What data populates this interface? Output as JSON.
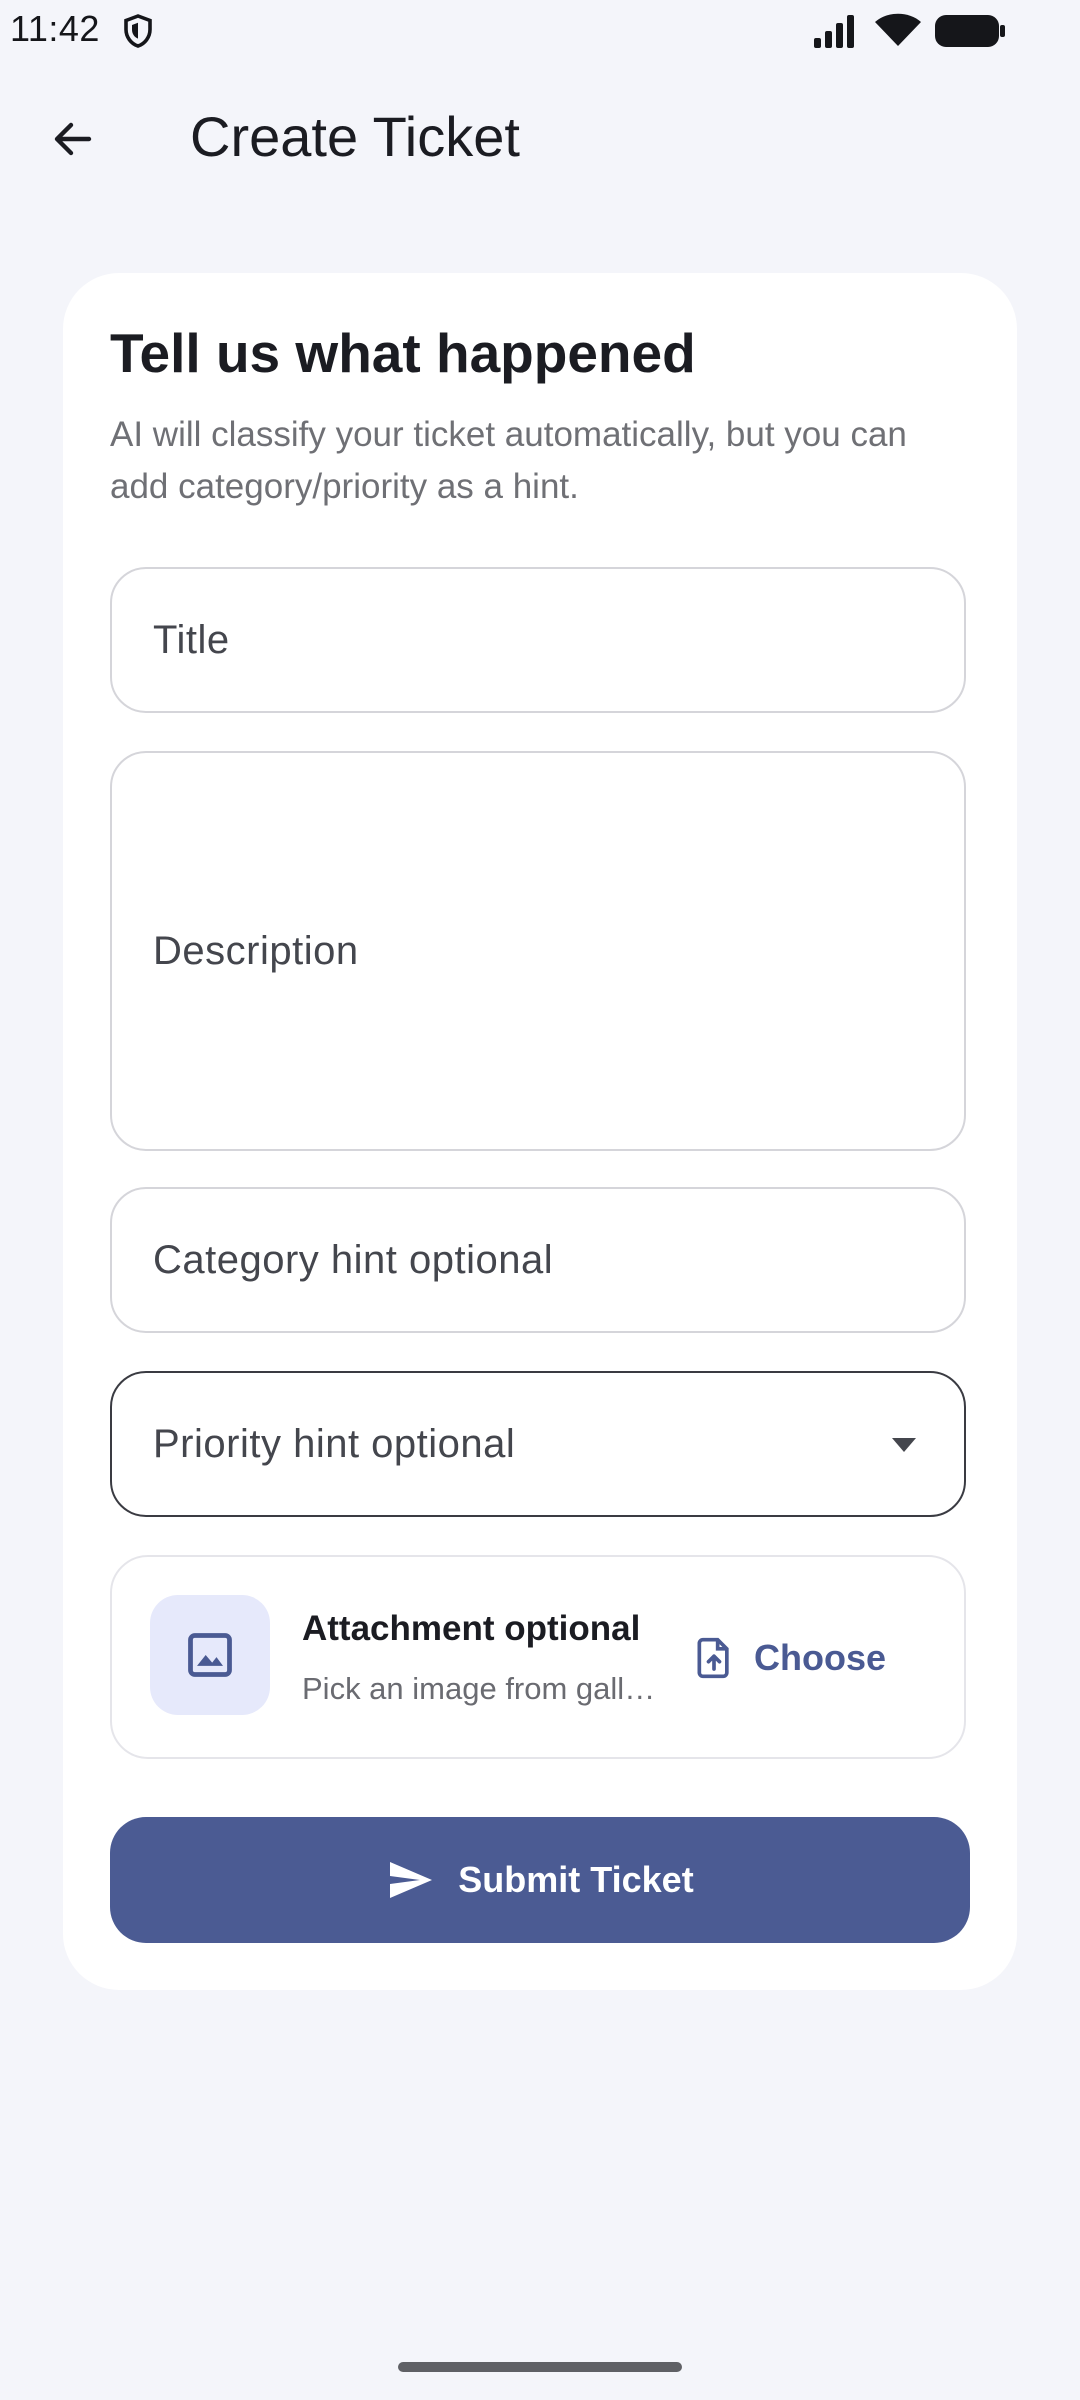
{
  "status_bar": {
    "time": "11:42"
  },
  "app_bar": {
    "title": "Create Ticket"
  },
  "card": {
    "heading": "Tell us what happened",
    "subtitle": "AI will classify your ticket automatically, but you can add category/priority as a hint."
  },
  "form": {
    "title_label": "Title",
    "description_label": "Description",
    "category_label": "Category hint optional",
    "priority_label": "Priority hint optional"
  },
  "attachment": {
    "title": "Attachment optional",
    "subtitle": "Pick an image from gallery",
    "choose_label": "Choose"
  },
  "submit": {
    "label": "Submit Ticket"
  },
  "colors": {
    "background": "#f4f5fa",
    "card": "#ffffff",
    "accent": "#4b5b93",
    "thumb_bg": "#e6e9fb"
  },
  "icons": {
    "back": "arrow-left",
    "dropdown": "caret-down",
    "image": "image",
    "file_upload": "file-upload",
    "send": "send"
  }
}
